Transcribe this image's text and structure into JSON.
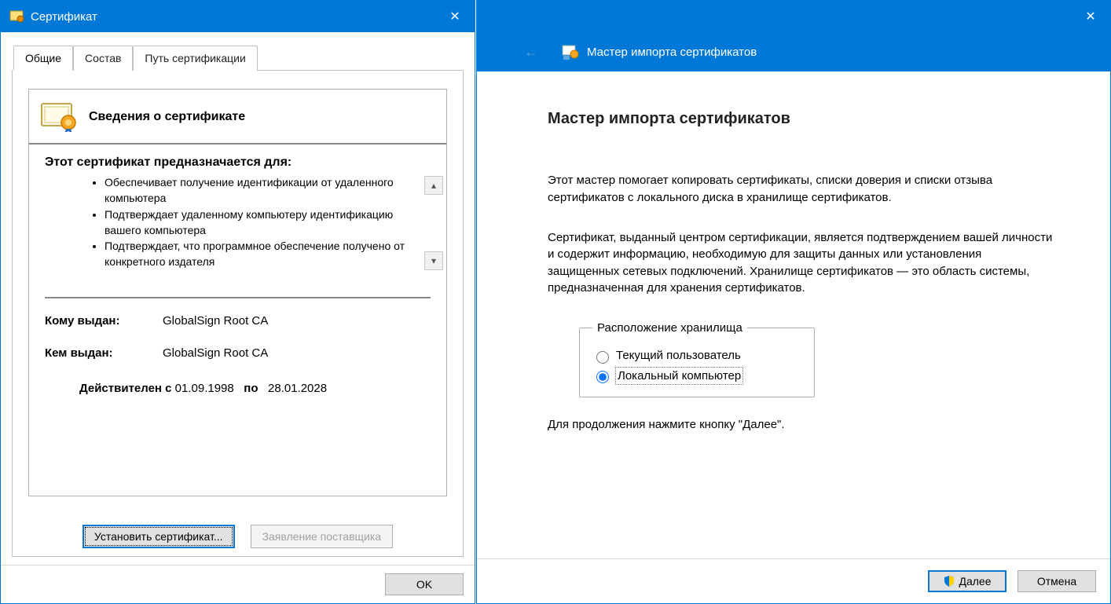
{
  "left": {
    "title": "Сертификат",
    "tabs": [
      "Общие",
      "Состав",
      "Путь сертификации"
    ],
    "info_header": "Сведения о сертификате",
    "purpose_title": "Этот сертификат предназначается для:",
    "purposes": [
      "Обеспечивает получение идентификации от удаленного компьютера",
      "Подтверждает удаленному компьютеру идентификацию вашего компьютера",
      "Подтверждает, что программное обеспечение получено от конкретного издателя"
    ],
    "issued_to_label": "Кому выдан:",
    "issued_to_value": "GlobalSign Root CA",
    "issued_by_label": "Кем выдан:",
    "issued_by_value": "GlobalSign Root CA",
    "valid_from_label": "Действителен с",
    "valid_from": "01.09.1998",
    "valid_to_label": "по",
    "valid_to": "28.01.2028",
    "install_button": "Установить сертификат...",
    "issuer_statement_button": "Заявление поставщика",
    "ok_button": "OK"
  },
  "right": {
    "header": "Мастер импорта сертификатов",
    "heading": "Мастер импорта сертификатов",
    "intro1": "Этот мастер помогает копировать сертификаты, списки доверия и списки отзыва сертификатов с локального диска в хранилище сертификатов.",
    "intro2": "Сертификат, выданный центром сертификации, является подтверждением вашей личности и содержит информацию, необходимую для защиты данных или установления защищенных сетевых подключений. Хранилище сертификатов — это область системы, предназначенная для хранения сертификатов.",
    "group_label": "Расположение хранилища",
    "radio_current_user": "Текущий пользователь",
    "radio_local_machine": "Локальный компьютер",
    "continue_hint": "Для продолжения нажмите кнопку \"Далее\".",
    "next_button": "Далее",
    "cancel_button": "Отмена"
  }
}
